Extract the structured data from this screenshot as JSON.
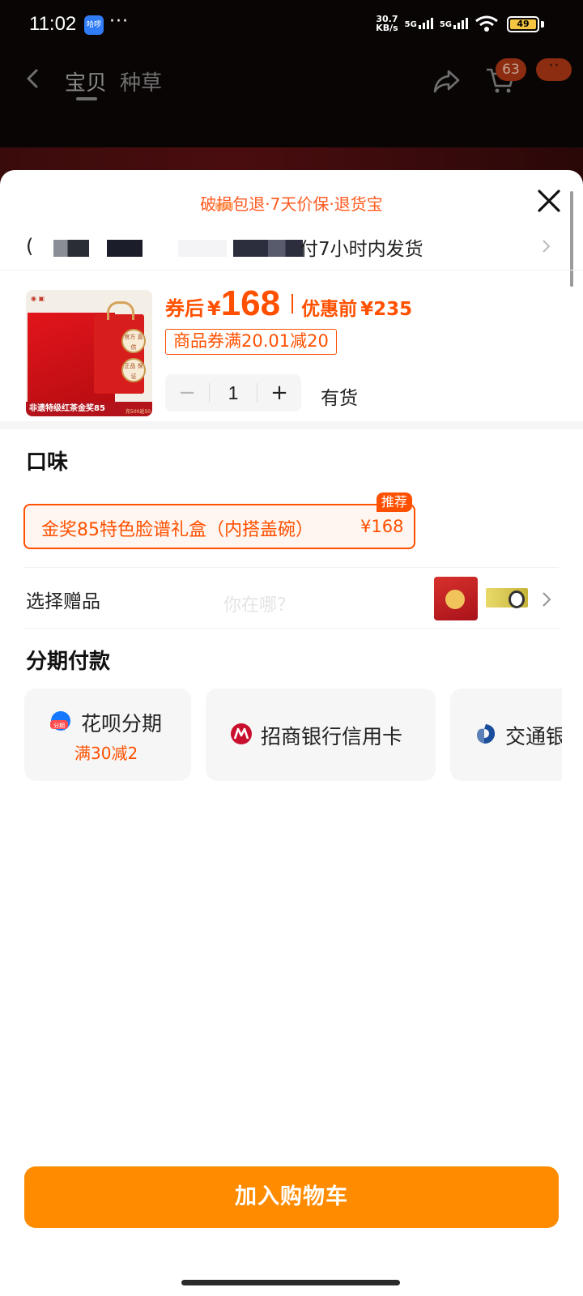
{
  "status_bar": {
    "time": "11:02",
    "app_badge": "哈啰",
    "dots": "···",
    "network_speed_value": "30.7",
    "network_speed_unit": "KB/s",
    "sim1": "5G",
    "sim2": "5G",
    "wifi_index": "6",
    "battery_level": "49"
  },
  "nav": {
    "tabs": [
      {
        "label": "宝贝",
        "active": true
      },
      {
        "label": "种草",
        "active": false
      }
    ],
    "cart_badge": "63",
    "more_badge": "··"
  },
  "sheet": {
    "promise": "破损包退·7天价保·退货宝",
    "shipping": {
      "prefix": "(",
      "text": "付7小时内发货"
    },
    "product": {
      "thumb_caption": "非遗特级红茶金奖85",
      "thumb_caption_side": "充500返50",
      "thumb_seal_1": "官方 直供",
      "thumb_seal_2": "正品 保证",
      "price_prefix": "券后",
      "price_currency": "¥",
      "price_value": "168",
      "orig_label": "优惠前",
      "orig_price": "¥235",
      "coupon": "商品券满20.01减20",
      "quantity": "1",
      "minus": "−",
      "plus": "+",
      "stock": "有货"
    },
    "flavor": {
      "title": "口味",
      "option_name": "金奖85特色脸谱礼盒（内搭盖碗）",
      "option_price": "¥168",
      "tag": "推荐"
    },
    "gift": {
      "label": "选择赠品",
      "ghost_text": "你在哪？"
    },
    "installment": {
      "title": "分期付款",
      "options": [
        {
          "name": "花呗分期",
          "sub": "满30减2"
        },
        {
          "name": "招商银行信用卡"
        },
        {
          "name": "交通银"
        }
      ]
    },
    "add_to_cart": "加入购物车"
  },
  "colors": {
    "accent": "#ff5000",
    "button": "#ff8b00"
  }
}
